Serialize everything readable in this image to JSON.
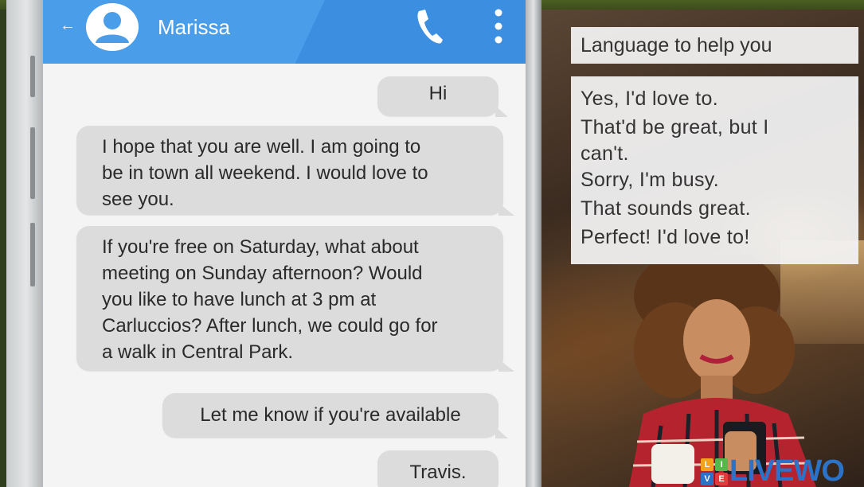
{
  "chat": {
    "contact_name": "Marissa",
    "messages": [
      {
        "direction": "sent",
        "text": "Hi"
      },
      {
        "direction": "received",
        "lines": [
          "I hope that you are well. I am going to",
          "be in town all weekend. I would love to",
          "see you."
        ]
      },
      {
        "direction": "received",
        "lines": [
          "If you're free on Saturday, what about",
          "meeting on Sunday afternoon? Would",
          "you like to have lunch at 3 pm at",
          "Carluccios? After lunch, we could go for",
          "a walk in Central Park."
        ]
      },
      {
        "direction": "sent",
        "text": "Let me know if you're available"
      },
      {
        "direction": "sent",
        "text": "Travis."
      }
    ]
  },
  "help_panel": {
    "title": "Language to help you",
    "phrases": [
      "Yes, I'd love to.",
      "That'd be great, but I",
      "can't.",
      "Sorry, I'm busy.",
      "That sounds great.",
      "Perfect! I'd love to!"
    ]
  },
  "logo": {
    "tiles": [
      "L",
      "I",
      "V",
      "E"
    ],
    "word": "LIVEWO"
  },
  "icons": {
    "back": "back-arrow-icon",
    "avatar": "user-avatar-icon",
    "call": "phone-call-icon",
    "menu": "more-vertical-icon"
  },
  "colors": {
    "app_bar": "#4a9de9",
    "bubble": "#dcdcdc",
    "background": "#2f3e1c"
  }
}
